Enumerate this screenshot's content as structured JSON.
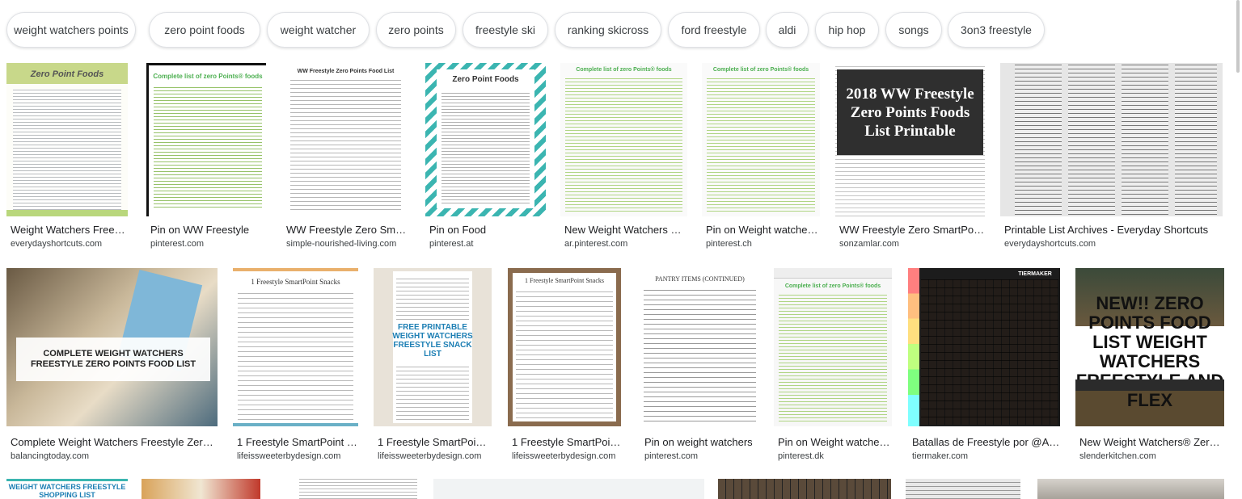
{
  "chips": [
    "weight watchers points",
    "zero point foods",
    "weight watcher",
    "zero points",
    "freestyle ski",
    "ranking skicross",
    "ford freestyle",
    "aldi",
    "hip hop",
    "songs",
    "3on3 freestyle"
  ],
  "row1": [
    {
      "title": "Weight Watchers Frees…",
      "source": "everydayshortcuts.com",
      "thumb_text": "Zero Point Foods"
    },
    {
      "title": "Pin on WW Freestyle",
      "source": "pinterest.com",
      "thumb_text": "Complete list of zero Points® foods"
    },
    {
      "title": "WW Freestyle Zero Sma…",
      "source": "simple-nourished-living.com",
      "thumb_text": "WW Freestyle Zero Points Food List"
    },
    {
      "title": "Pin on Food",
      "source": "pinterest.at",
      "thumb_text": "Zero Point Foods"
    },
    {
      "title": "New Weight Watchers F…",
      "source": "ar.pinterest.com",
      "thumb_text": "Complete list of zero Points® foods"
    },
    {
      "title": "Pin on Weight watcher…",
      "source": "pinterest.ch",
      "thumb_text": "Complete list of zero Points® foods"
    },
    {
      "title": "WW Freestyle Zero SmartPoi…",
      "source": "sonzamlar.com",
      "thumb_text": "2018 WW Freestyle Zero Points Foods List Printable"
    },
    {
      "title": "Printable List Archives - Everyday Shortcuts",
      "source": "everydayshortcuts.com",
      "thumb_text": ""
    }
  ],
  "row2": [
    {
      "title": "Complete Weight Watchers Freestyle Zero …",
      "source": "balancingtoday.com",
      "thumb_text": "COMPLETE WEIGHT WATCHERS FREESTYLE ZERO POINTS FOOD LIST"
    },
    {
      "title": "1 Freestyle SmartPoint …",
      "source": "lifeissweeterbydesign.com",
      "thumb_text": "1 Freestyle SmartPoint Snacks"
    },
    {
      "title": "1 Freestyle SmartPoin…",
      "source": "lifeissweeterbydesign.com",
      "thumb_text": "FREE PRINTABLE WEIGHT WATCHERS FREESTYLE SNACK LIST"
    },
    {
      "title": "1 Freestyle SmartPoin…",
      "source": "lifeissweeterbydesign.com",
      "thumb_text": "1 Freestyle SmartPoint Snacks"
    },
    {
      "title": "Pin on weight watchers",
      "source": "pinterest.com",
      "thumb_text": "PANTRY ITEMS (CONTINUED)"
    },
    {
      "title": "Pin on Weight watcher…",
      "source": "pinterest.dk",
      "thumb_text": "Complete list of zero Points® foods"
    },
    {
      "title": "Batallas de Freestyle por @Al…",
      "source": "tiermaker.com",
      "thumb_text": "TIERMAKER"
    },
    {
      "title": "New Weight Watchers® Zero…",
      "source": "slenderkitchen.com",
      "thumb_text": "NEW!! ZERO POINTS FOOD LIST WEIGHT WATCHERS FREESTYLE AND FLEX"
    }
  ],
  "row3_text": "WEIGHT WATCHERS FREESTYLE SHOPPING LIST",
  "colors": {
    "chip_border": "#dfe1e5",
    "source_text": "#3c4043",
    "title_text": "#202124",
    "teal": "#3bb5b1",
    "dark_tile": "#2f2f2f"
  }
}
